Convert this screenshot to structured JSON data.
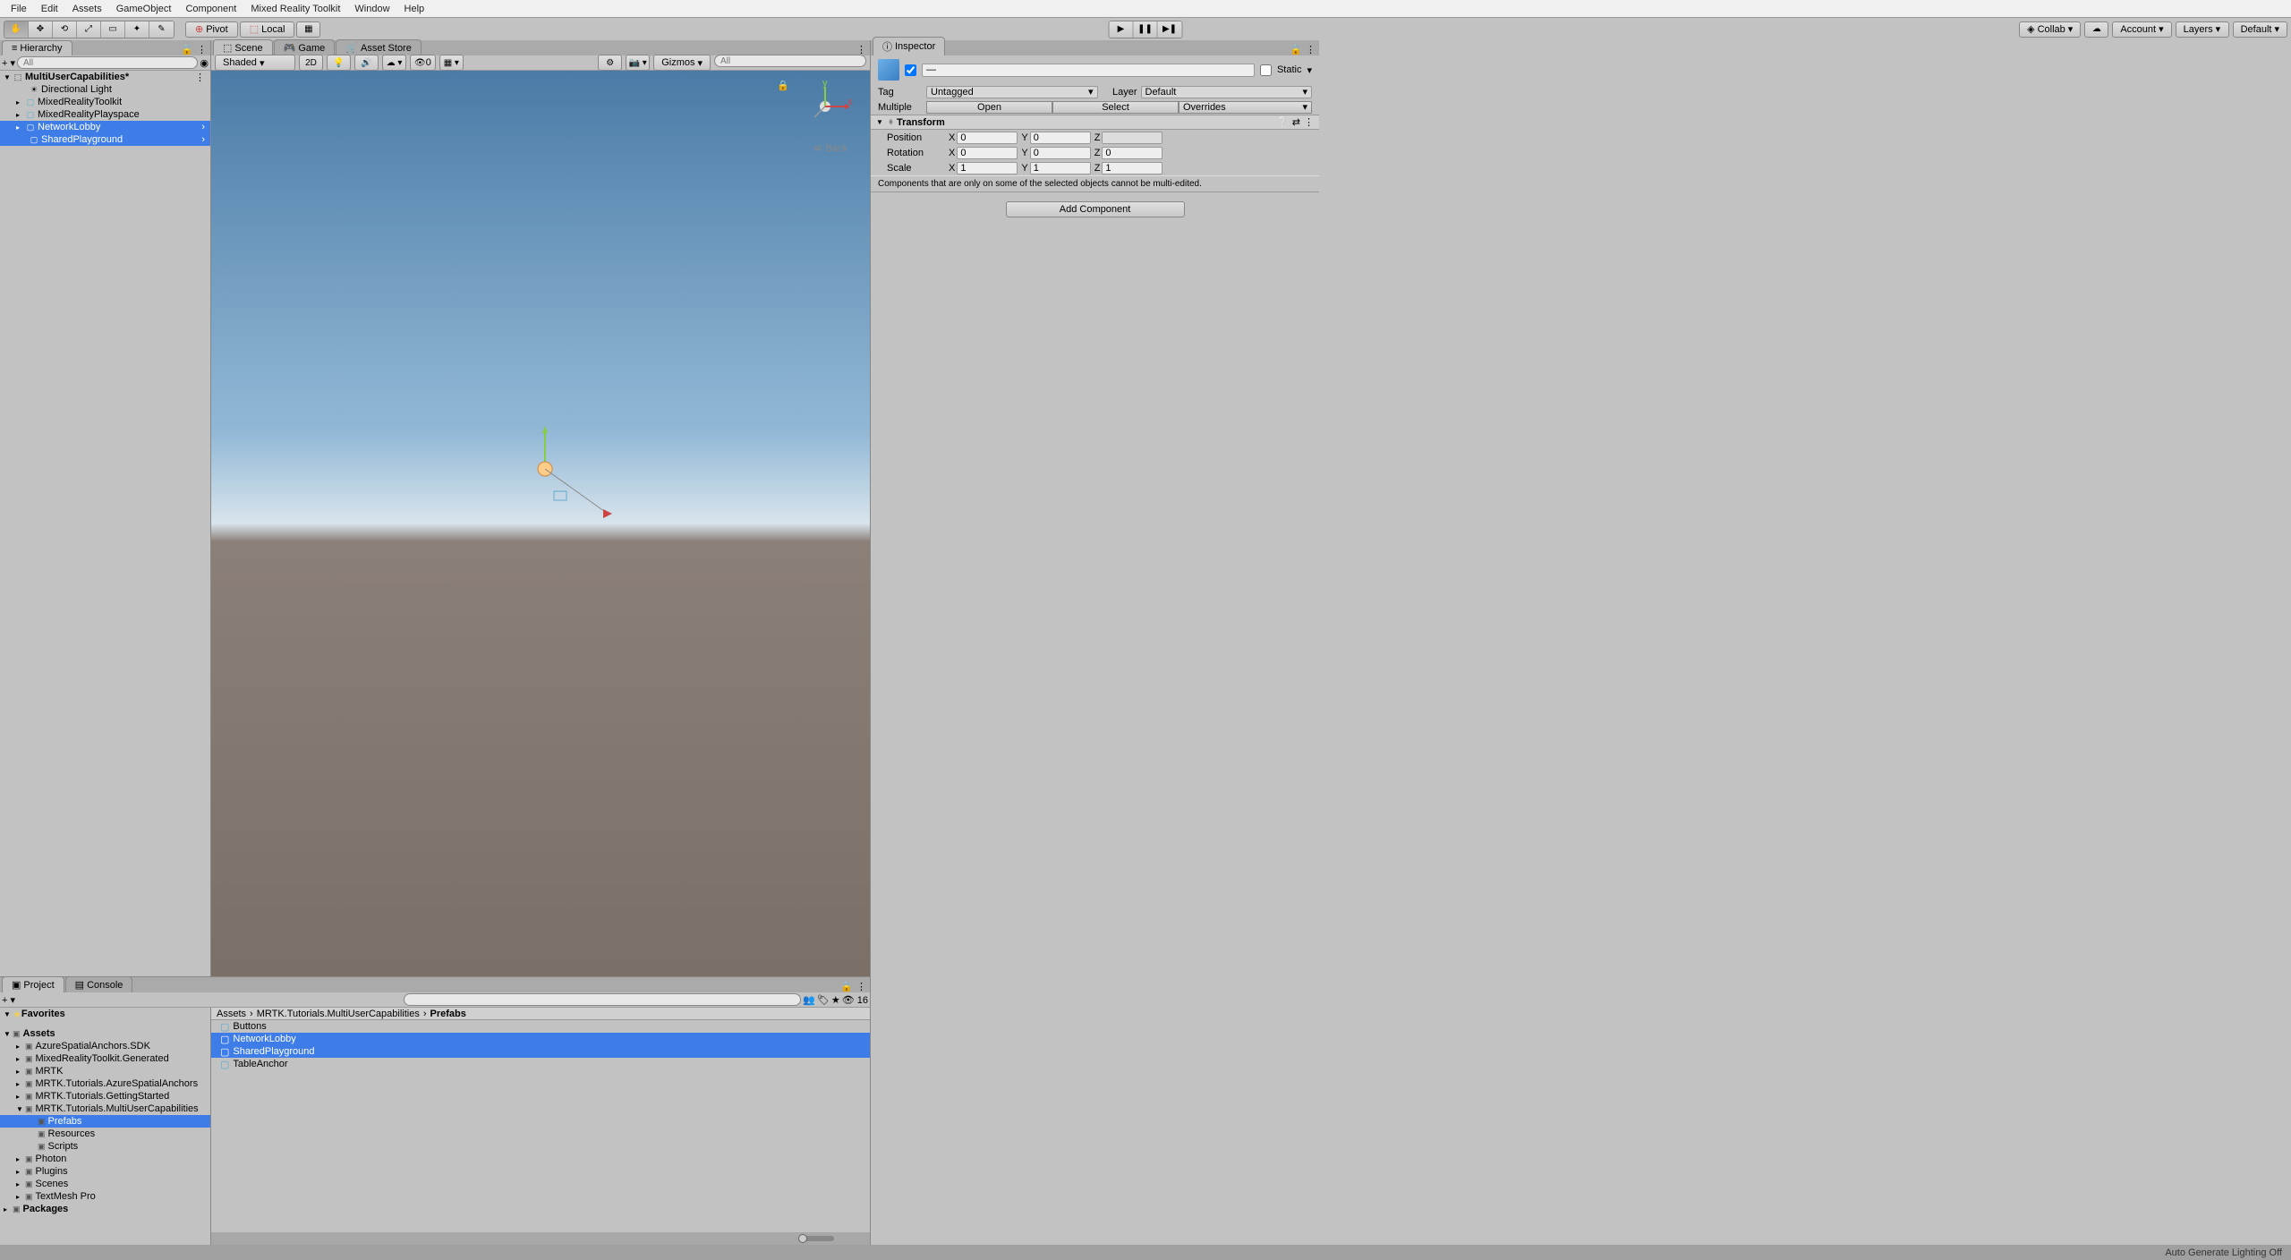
{
  "menubar": [
    "File",
    "Edit",
    "Assets",
    "GameObject",
    "Component",
    "Mixed Reality Toolkit",
    "Window",
    "Help"
  ],
  "toolbar": {
    "pivot": "Pivot",
    "local": "Local",
    "collab": "Collab",
    "account": "Account",
    "layers": "Layers",
    "layout": "Default"
  },
  "hierarchy": {
    "title": "Hierarchy",
    "search_ph": "All",
    "scene": "MultiUserCapabilities*",
    "items": [
      "Directional Light",
      "MixedRealityToolkit",
      "MixedRealityPlayspace",
      "NetworkLobby",
      "SharedPlayground"
    ]
  },
  "scene_tabs": {
    "scene": "Scene",
    "game": "Game",
    "asset_store": "Asset Store"
  },
  "scene_tb": {
    "shaded": "Shaded",
    "twod": "2D",
    "hidden": "0",
    "gizmos": "Gizmos",
    "search_ph": "All",
    "back": "Back"
  },
  "project": {
    "title": "Project",
    "console": "Console",
    "count": "16",
    "favorites": "Favorites",
    "assets": "Assets",
    "tree": [
      {
        "n": "AzureSpatialAnchors.SDK",
        "d": 1
      },
      {
        "n": "MixedRealityToolkit.Generated",
        "d": 1
      },
      {
        "n": "MRTK",
        "d": 1
      },
      {
        "n": "MRTK.Tutorials.AzureSpatialAnchors",
        "d": 1
      },
      {
        "n": "MRTK.Tutorials.GettingStarted",
        "d": 1
      },
      {
        "n": "MRTK.Tutorials.MultiUserCapabilities",
        "d": 1,
        "open": true
      },
      {
        "n": "Prefabs",
        "d": 2,
        "sel": true
      },
      {
        "n": "Resources",
        "d": 2
      },
      {
        "n": "Scripts",
        "d": 2
      },
      {
        "n": "Photon",
        "d": 1
      },
      {
        "n": "Plugins",
        "d": 1
      },
      {
        "n": "Scenes",
        "d": 1
      },
      {
        "n": "TextMesh Pro",
        "d": 1
      }
    ],
    "packages": "Packages",
    "crumb": [
      "Assets",
      "MRTK.Tutorials.MultiUserCapabilities",
      "Prefabs"
    ],
    "items": [
      "Buttons",
      "NetworkLobby",
      "SharedPlayground",
      "TableAnchor"
    ]
  },
  "inspector": {
    "title": "Inspector",
    "dash": "—",
    "static": "Static",
    "tag_l": "Tag",
    "tag_v": "Untagged",
    "layer_l": "Layer",
    "layer_v": "Default",
    "multiple": "Multiple",
    "open": "Open",
    "select": "Select",
    "overrides": "Overrides",
    "transform": "Transform",
    "position": "Position",
    "rotation": "Rotation",
    "scale": "Scale",
    "pos": {
      "x": "0",
      "y": "0",
      "z": ""
    },
    "rot": {
      "x": "0",
      "y": "0",
      "z": "0"
    },
    "scl": {
      "x": "1",
      "y": "1",
      "z": "1"
    },
    "msg": "Components that are only on some of the selected objects cannot be multi-edited.",
    "add": "Add Component"
  },
  "status": "Auto Generate Lighting Off"
}
